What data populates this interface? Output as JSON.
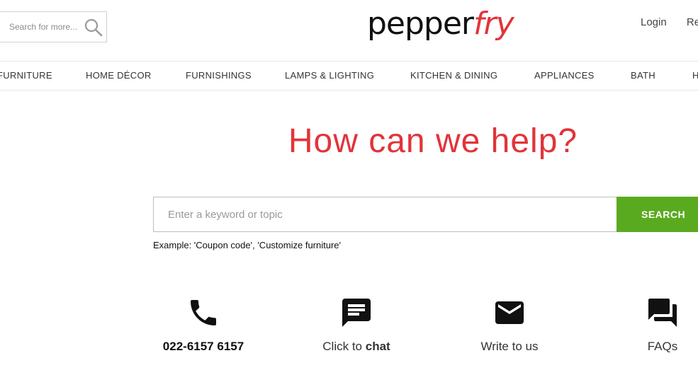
{
  "header": {
    "search_placeholder": "Search for more...",
    "logo_part1": "pepper",
    "logo_part2": "fry",
    "login_label": "Login",
    "register_label": "Re"
  },
  "nav": {
    "items": [
      "FURNITURE",
      "HOME DÉCOR",
      "FURNISHINGS",
      "LAMPS & LIGHTING",
      "KITCHEN & DINING",
      "APPLIANCES",
      "BATH",
      "H"
    ]
  },
  "help": {
    "title": "How can we help?",
    "search_placeholder": "Enter a keyword or topic",
    "search_button": "SEARCH",
    "example": "Example: 'Coupon code', 'Customize furniture'"
  },
  "contacts": {
    "phone": "022-6157 6157",
    "chat_prefix": "Click to ",
    "chat_bold": "chat",
    "write": "Write to us",
    "faqs": "FAQs"
  },
  "colors": {
    "brand_red": "#e1343a",
    "search_green": "#5aaa1f"
  }
}
